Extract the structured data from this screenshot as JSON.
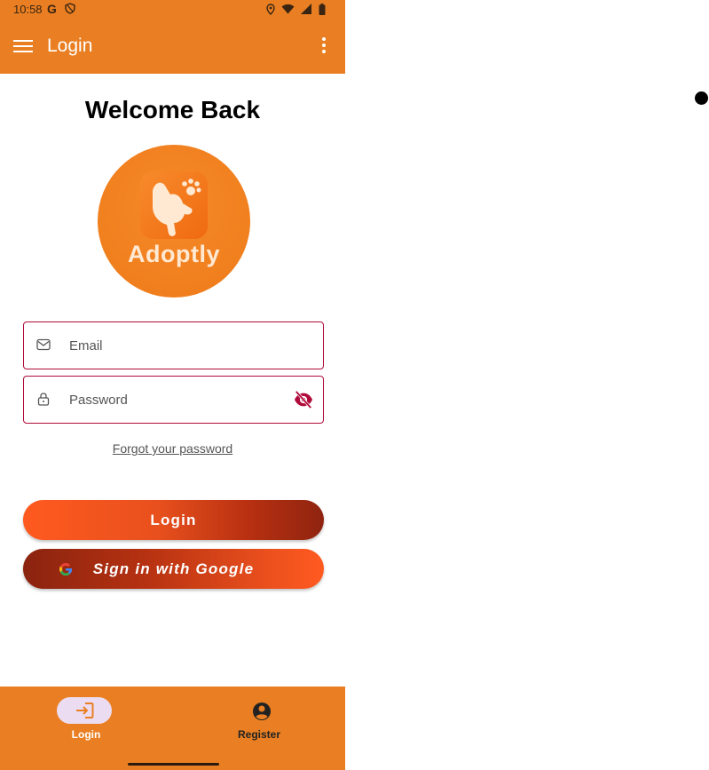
{
  "status_bar": {
    "time": "10:58",
    "g_letter": "G"
  },
  "app_bar": {
    "title": "Login",
    "menu_icon": "hamburger-menu-icon",
    "more_icon": "overflow-menu-icon"
  },
  "welcome": "Welcome Back",
  "logo": {
    "brand_name": "Adoptly",
    "icon": "pet-logo-icon"
  },
  "form": {
    "email": {
      "placeholder": "Email",
      "value": "",
      "icon": "mail-icon"
    },
    "password": {
      "placeholder": "Password",
      "value": "",
      "icon": "lock-icon",
      "toggle_icon": "visibility-off-icon"
    },
    "forgot": "Forgot your password"
  },
  "buttons": {
    "login": "Login",
    "google": "Sign in with Google"
  },
  "bottom_nav": {
    "items": [
      {
        "label": "Login",
        "icon": "login-arrow-icon",
        "selected": true
      },
      {
        "label": "Register",
        "icon": "account-circle-icon",
        "selected": false
      }
    ]
  },
  "colors": {
    "primary": "#e97f22",
    "error_border": "#b00a3a",
    "gradient_dark": "#8f2410",
    "gradient_light": "#ff5a1f"
  }
}
